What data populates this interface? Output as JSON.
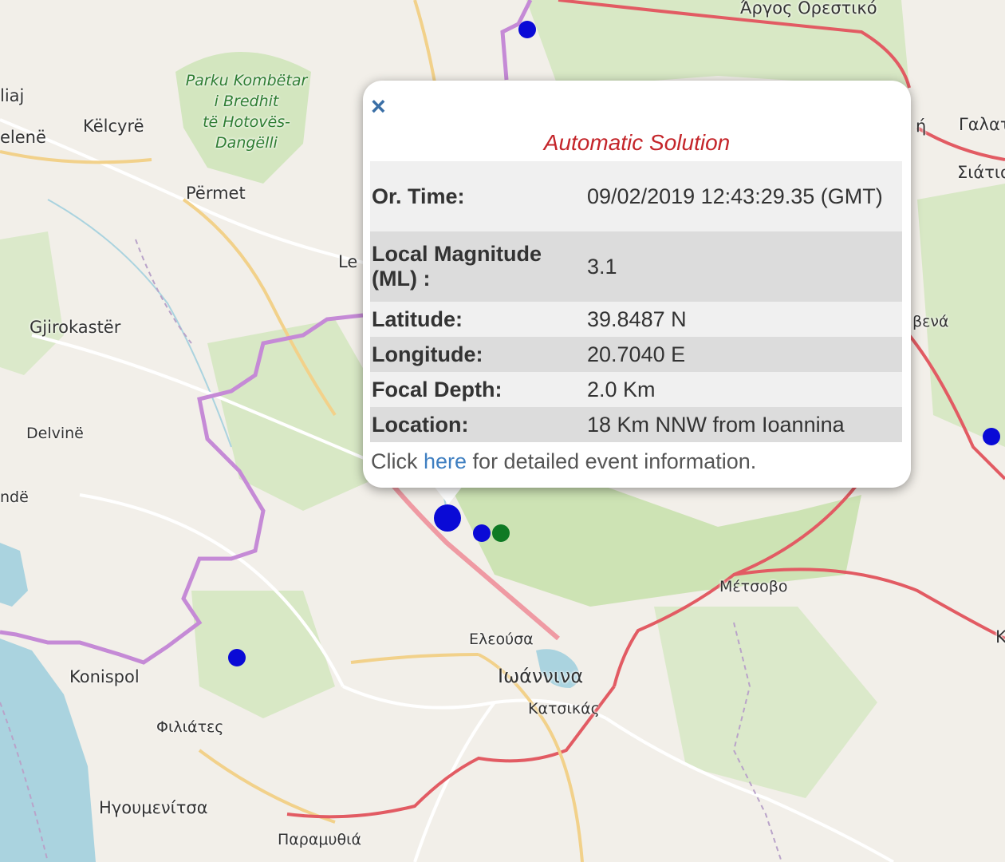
{
  "popup": {
    "close_symbol": "×",
    "heading": "Automatic Solution",
    "rows": [
      {
        "label": "Or. Time:",
        "value": "09/02/2019 12:43:29.35 (GMT)"
      },
      {
        "label": "Local Magnitude (ML) :",
        "value": "3.1"
      },
      {
        "label": "Latitude:",
        "value": "39.8487 N"
      },
      {
        "label": "Longitude:",
        "value": "20.7040 E"
      },
      {
        "label": "Focal Depth:",
        "value": "2.0 Km"
      },
      {
        "label": "Location:",
        "value": "18 Km NNW from Ioannina"
      }
    ],
    "footer_prefix": "Click ",
    "footer_link": "here",
    "footer_suffix": " for detailed event information."
  },
  "places": {
    "argos_orestiko": "Άργος Ορεστικό",
    "park_line1": "Parku Kombëtar",
    "park_line2": "i Bredhit",
    "park_line3": "të Hotovës-",
    "park_line4": "Dangëlli",
    "liaj": "liaj",
    "elene": "elenë",
    "kelcyre": "Këlcyrë",
    "permet": "Përmet",
    "le": "Le",
    "gjirokaster": "Gjirokastër",
    "delvine": "Delvinë",
    "nde": "ndë",
    "konispol": "Konispol",
    "filiates": "Φιλιάτες",
    "igoumenitsa": "Ηγουμενίτσα",
    "paramythia": "Παραμυθιά",
    "eleousa": "Ελεούσα",
    "ioannina": "Ιωάννινα",
    "katsikas": "Κατσικάς",
    "metsovo": "Μέτσοβο",
    "galata": "Γαλατ",
    "siatista": "Σιάτισ",
    "deskati_partial": "βενά",
    "h_partial": "ή",
    "k_partial": "Κ"
  },
  "colors": {
    "event_blue": "#0a0ad6",
    "event_green": "#0f7a24",
    "border": "#c58ad6",
    "major_road": "#e25b63",
    "water": "#aad3df",
    "forest": "#cfe4b7",
    "heading": "#c4252a",
    "link": "#3f7fc1"
  }
}
